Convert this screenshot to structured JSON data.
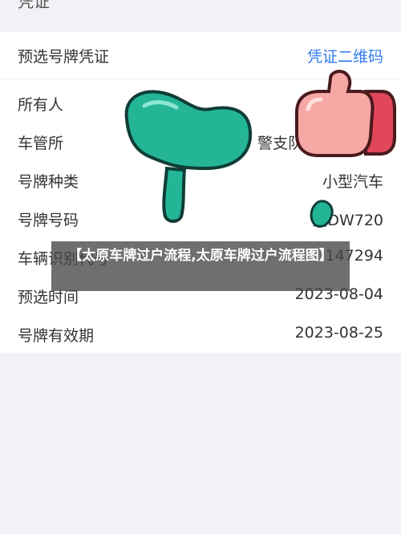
{
  "header": {
    "partial_title": "凭证"
  },
  "card": {
    "title": "预选号牌凭证",
    "qr_link": "凭证二维码",
    "rows": [
      {
        "label": "所有人",
        "value": ""
      },
      {
        "label": "车管所",
        "value": "警支队"
      },
      {
        "label": "号牌种类",
        "value": "小型汽车"
      },
      {
        "label": "号牌号码",
        "value": "湘DW720"
      },
      {
        "label": "车辆识别代号",
        "value": "147294"
      },
      {
        "label": "预选时间",
        "value": "2023-08-04"
      },
      {
        "label": "号牌有效期",
        "value": "2023-08-25"
      }
    ]
  },
  "overlay": {
    "title": "【太原车牌过户流程,太原车牌过户流程图】"
  },
  "icons": {
    "sprout": "sprout-icon",
    "thumb": "thumbs-up-icon",
    "bean": "bean-icon"
  },
  "colors": {
    "accent": "#2f7bf0",
    "sprout": "#24b596",
    "thumb": "#f07a80"
  }
}
